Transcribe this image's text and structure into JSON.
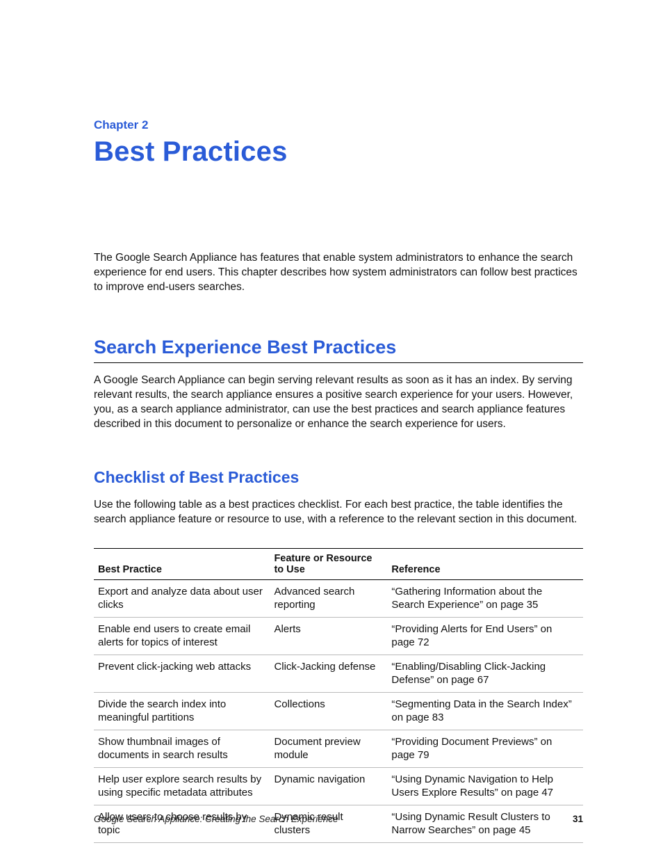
{
  "chapter": {
    "label": "Chapter 2",
    "title": "Best Practices"
  },
  "intro": "The Google Search Appliance has features that enable system administrators to enhance the search experience for end users. This chapter describes how system administrators can follow best practices to improve end-users searches.",
  "section": {
    "title": "Search Experience Best Practices",
    "para": "A Google Search Appliance can begin serving relevant results as soon as it has an index. By serving relevant results, the search appliance ensures a positive search experience for your users. However, you, as a search appliance administrator, can use the best practices and search appliance features described in this document to personalize or enhance the search experience for users."
  },
  "sub": {
    "title": "Checklist of Best Practices",
    "para": "Use the following table as a best practices checklist. For each best practice, the table identifies the search appliance feature or resource to use, with a reference to the relevant section in this document."
  },
  "table": {
    "headers": [
      "Best Practice",
      "Feature or Resource to Use",
      "Reference"
    ],
    "rows": [
      {
        "practice": "Export and analyze data about user clicks",
        "feature": "Advanced search reporting",
        "reference": "“Gathering Information about the Search Experience” on page 35"
      },
      {
        "practice": "Enable end users to create email alerts for topics of interest",
        "feature": "Alerts",
        "reference": "“Providing Alerts for End Users” on page 72"
      },
      {
        "practice": "Prevent click-jacking web attacks",
        "feature": "Click-Jacking defense",
        "reference": "“Enabling/Disabling Click-Jacking Defense” on page 67"
      },
      {
        "practice": "Divide the search index into meaningful partitions",
        "feature": "Collections",
        "reference": "“Segmenting Data in the Search Index” on page 83"
      },
      {
        "practice": "Show thumbnail images of documents in search results",
        "feature": "Document preview module",
        "reference": "“Providing Document Previews” on page 79"
      },
      {
        "practice": "Help user explore search results by using specific metadata attributes",
        "feature": "Dynamic navigation",
        "reference": "“Using Dynamic Navigation to Help Users Explore Results” on page 47"
      },
      {
        "practice": "Allow users to choose results by topic",
        "feature": "Dynamic result clusters",
        "reference": "“Using Dynamic Result Clusters to Narrow Searches” on page 45"
      }
    ]
  },
  "footer": {
    "title": "Google Search Appliance: Creating the Search Experience",
    "page": "31"
  }
}
